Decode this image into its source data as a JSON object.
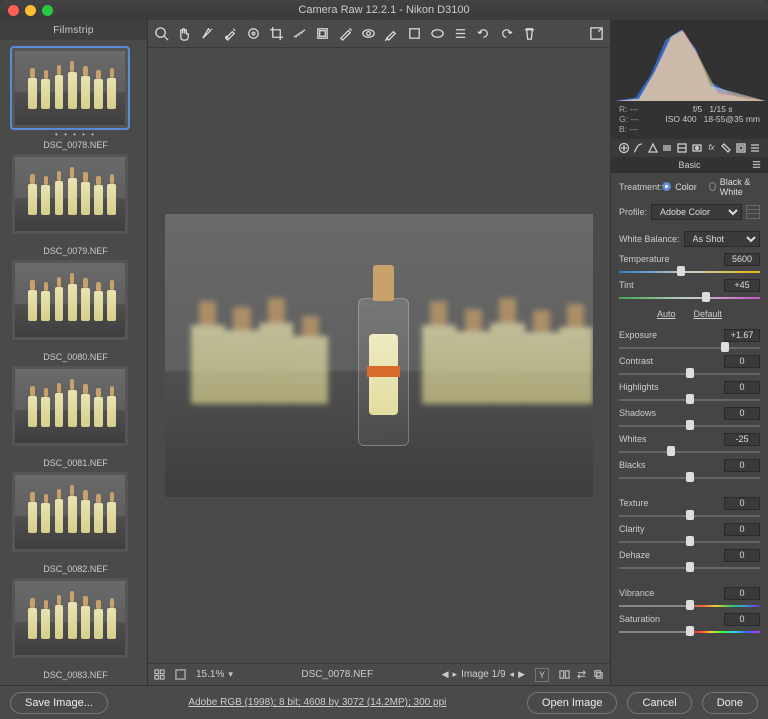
{
  "title": "Camera Raw 12.2.1  -  Nikon D3100",
  "filmstrip": {
    "header": "Filmstrip",
    "selected": 0,
    "thumbs": [
      {
        "name": "DSC_0078.NEF",
        "dots": "• • • • •"
      },
      {
        "name": "DSC_0079.NEF",
        "dots": ""
      },
      {
        "name": "DSC_0080.NEF",
        "dots": ""
      },
      {
        "name": "DSC_0081.NEF",
        "dots": ""
      },
      {
        "name": "DSC_0082.NEF",
        "dots": ""
      },
      {
        "name": "DSC_0083.NEF",
        "dots": ""
      }
    ]
  },
  "status": {
    "zoom": "15.1%",
    "filename": "DSC_0078.NEF",
    "counter": "Image 1/9",
    "y": "Y"
  },
  "meta": {
    "R": "R:   ---",
    "G": "G:   ---",
    "B": "B:   ---",
    "aperture": "f/5",
    "shutter": "1/15 s",
    "iso": "ISO 400",
    "lens": "18-55@35 mm"
  },
  "panel": {
    "section": "Basic",
    "treatment": {
      "label": "Treatment:",
      "color": "Color",
      "bw": "Black & White"
    },
    "profile": {
      "label": "Profile:",
      "value": "Adobe Color"
    },
    "wb": {
      "label": "White Balance:",
      "value": "As Shot"
    },
    "auto": "Auto",
    "default": "Default",
    "sliders": {
      "Temperature": {
        "value": "5600",
        "pos": 44,
        "track": "color"
      },
      "Tint": {
        "value": "+45",
        "pos": 62,
        "track": "tint"
      },
      "Exposure": {
        "value": "+1.67",
        "pos": 75
      },
      "Contrast": {
        "value": "0",
        "pos": 50
      },
      "Highlights": {
        "value": "0",
        "pos": 50
      },
      "Shadows": {
        "value": "0",
        "pos": 50
      },
      "Whites": {
        "value": "-25",
        "pos": 37
      },
      "Blacks": {
        "value": "0",
        "pos": 50
      },
      "Texture": {
        "value": "0",
        "pos": 50
      },
      "Clarity": {
        "value": "0",
        "pos": 50
      },
      "Dehaze": {
        "value": "0",
        "pos": 50
      },
      "Vibrance": {
        "value": "0",
        "pos": 50,
        "track": "vib"
      },
      "Saturation": {
        "value": "0",
        "pos": 50,
        "track": "sat"
      }
    }
  },
  "footer": {
    "save": "Save Image...",
    "workflow": "Adobe RGB (1998); 8 bit; 4608 by 3072 (14.2MP); 300 ppi",
    "open": "Open Image",
    "cancel": "Cancel",
    "done": "Done"
  }
}
